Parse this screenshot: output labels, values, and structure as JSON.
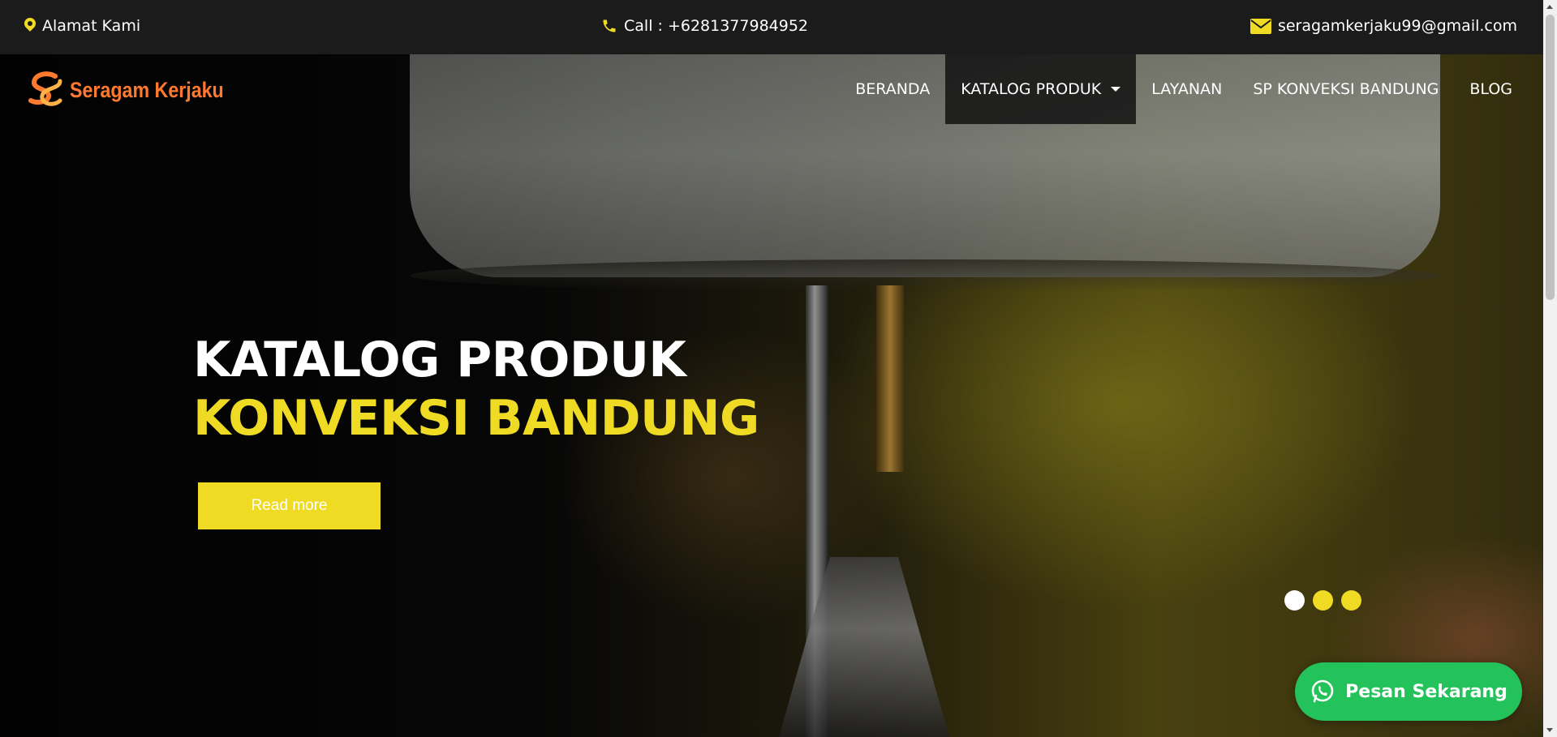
{
  "topbar": {
    "address_label": "Alamat Kami",
    "call_label": "Call : +6281377984952",
    "email_label": "seragamkerjaku99@gmail.com",
    "address_icon": "map-pin-icon",
    "call_icon": "phone-icon",
    "email_icon": "envelope-icon"
  },
  "brand": {
    "name": "Seragam Kerjaku",
    "color": "#ff7a2f"
  },
  "nav": {
    "items": [
      {
        "label": "BERANDA"
      },
      {
        "label": "KATALOG PRODUK",
        "active": true,
        "dropdown": true
      },
      {
        "label": "LAYANAN"
      },
      {
        "label": "SP KONVEKSI BANDUNG"
      },
      {
        "label": "BLOG"
      }
    ]
  },
  "hero": {
    "title_line1": "KATALOG PRODUK",
    "title_line2": "KONVEKSI BANDUNG",
    "button_label": "Read more",
    "slides": 3,
    "active_slide": 1
  },
  "whatsapp": {
    "label": "Pesan Sekarang",
    "icon": "whatsapp-icon"
  },
  "colors": {
    "accent": "#f0db24",
    "topbar_bg": "#1b1b1b",
    "whatsapp": "#24c25a",
    "brand_orange": "#ff7a2f"
  }
}
